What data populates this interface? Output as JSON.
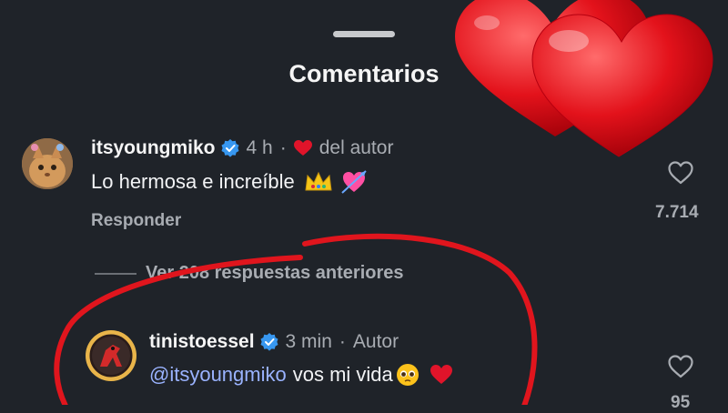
{
  "sheet": {
    "title": "Comentarios"
  },
  "comments": [
    {
      "username": "itsyoungmiko",
      "time": "4 h",
      "separator": "·",
      "liked_by_author_label": "del autor",
      "text": "Lo hermosa e increíble",
      "emojis": [
        "crown-emoji",
        "heart-arrow-emoji"
      ],
      "reply_label": "Responder",
      "likes": "7.714"
    },
    {
      "username": "tinistoessel",
      "time": "3 min",
      "separator": "·",
      "author_label": "Autor",
      "mention": "@itsyoungmiko",
      "text": "vos mi vida",
      "emojis": [
        "pleading-face-emoji",
        "red-heart-emoji"
      ],
      "likes": "95"
    }
  ],
  "replies": {
    "label": "Ver 208 respuestas anteriores"
  },
  "colors": {
    "background": "#1f2329",
    "verified": "#3797f0",
    "like_red": "#e0142a",
    "annotation_red": "#e0151d"
  },
  "icons": [
    "verified-badge-icon",
    "heart-outline-icon",
    "red-heart-icon"
  ]
}
